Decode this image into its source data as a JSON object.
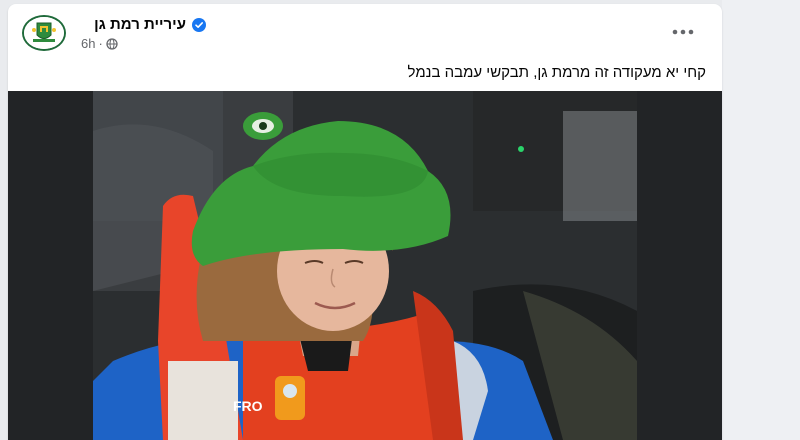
{
  "post": {
    "page_name": "עיריית רמת גן",
    "verified_icon": "verified-badge-icon",
    "timestamp": "6h",
    "separator": "·",
    "audience_icon": "globe-icon",
    "more_icon": "more-horizontal-icon",
    "text": "קחי יא מעקודה זה מרמת גן, תבקשי עמבה בנמל",
    "image_description_icon": "photo"
  },
  "colors": {
    "verified_blue": "#1877f2",
    "meta_gray": "#65676b",
    "hat_green": "#3a9d3a",
    "vest_orange": "#e8452a",
    "jacket_blue": "#1e63c6"
  }
}
